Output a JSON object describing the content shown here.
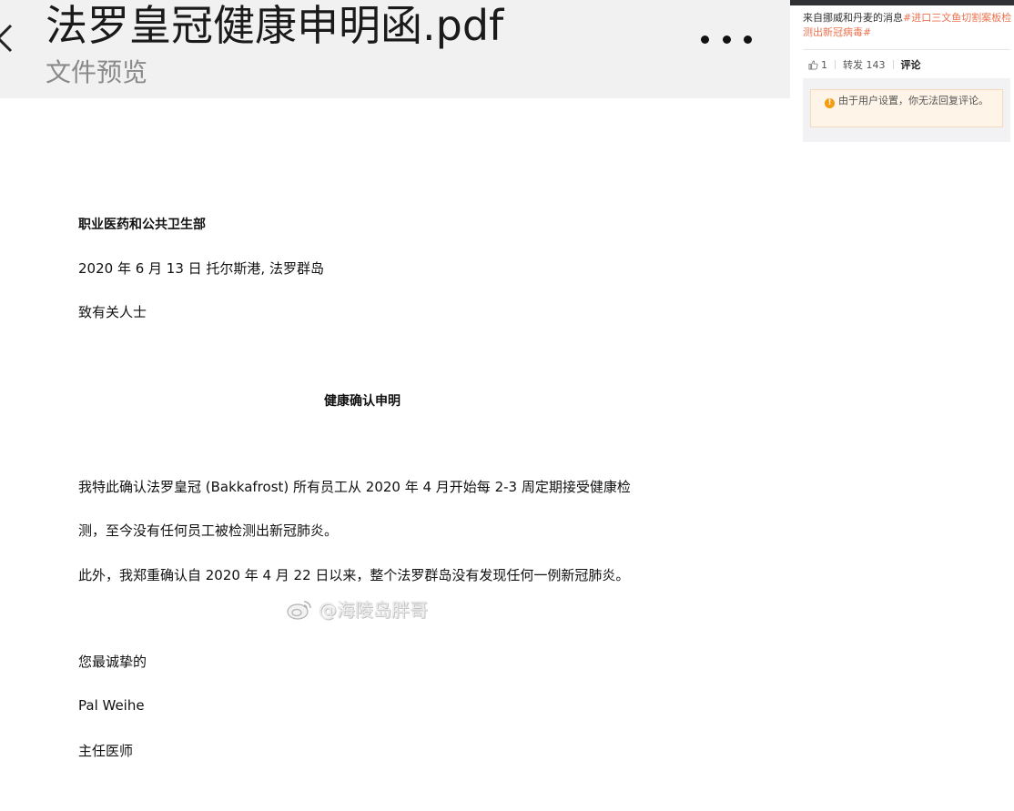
{
  "header": {
    "title": "法罗皇冠健康申明函.pdf",
    "subtitle": "文件预览"
  },
  "letter": {
    "department": "职业医药和公共卫生部",
    "date_place": "2020 年 6 月 13 日 托尔斯港, 法罗群岛",
    "salutation": "致有关人士",
    "heading": "健康确认申明",
    "para1_line1": "我特此确认法罗皇冠 (Bakkafrost) 所有员工从 2020 年 4 月开始每 2-3 周定期接受健康检",
    "para1_line2": "测，至今没有任何员工被检测出新冠肺炎。",
    "para2": "此外，我郑重确认自 2020 年 4 月 22 日以来，整个法罗群岛没有发现任何一例新冠肺炎。",
    "closing": "您最诚挚的",
    "signer_name": "Pal Weihe",
    "signer_title": "主任医师"
  },
  "watermark": {
    "text": "@海陵岛胖哥"
  },
  "weibo": {
    "post_text": "来自挪威和丹麦的消息",
    "hashtag": "#进口三文鱼切割案板检测出新冠病毒#",
    "like_count": "1",
    "repost_label": "转发 143",
    "comment_label": "评论",
    "notice": "由于用户设置，你无法回复评论。"
  },
  "colors": {
    "hashtag": "#eb7350",
    "header_bg": "#f1f1f1",
    "notice_bg": "#fff4e8",
    "warn_icon": "#f39c12"
  }
}
